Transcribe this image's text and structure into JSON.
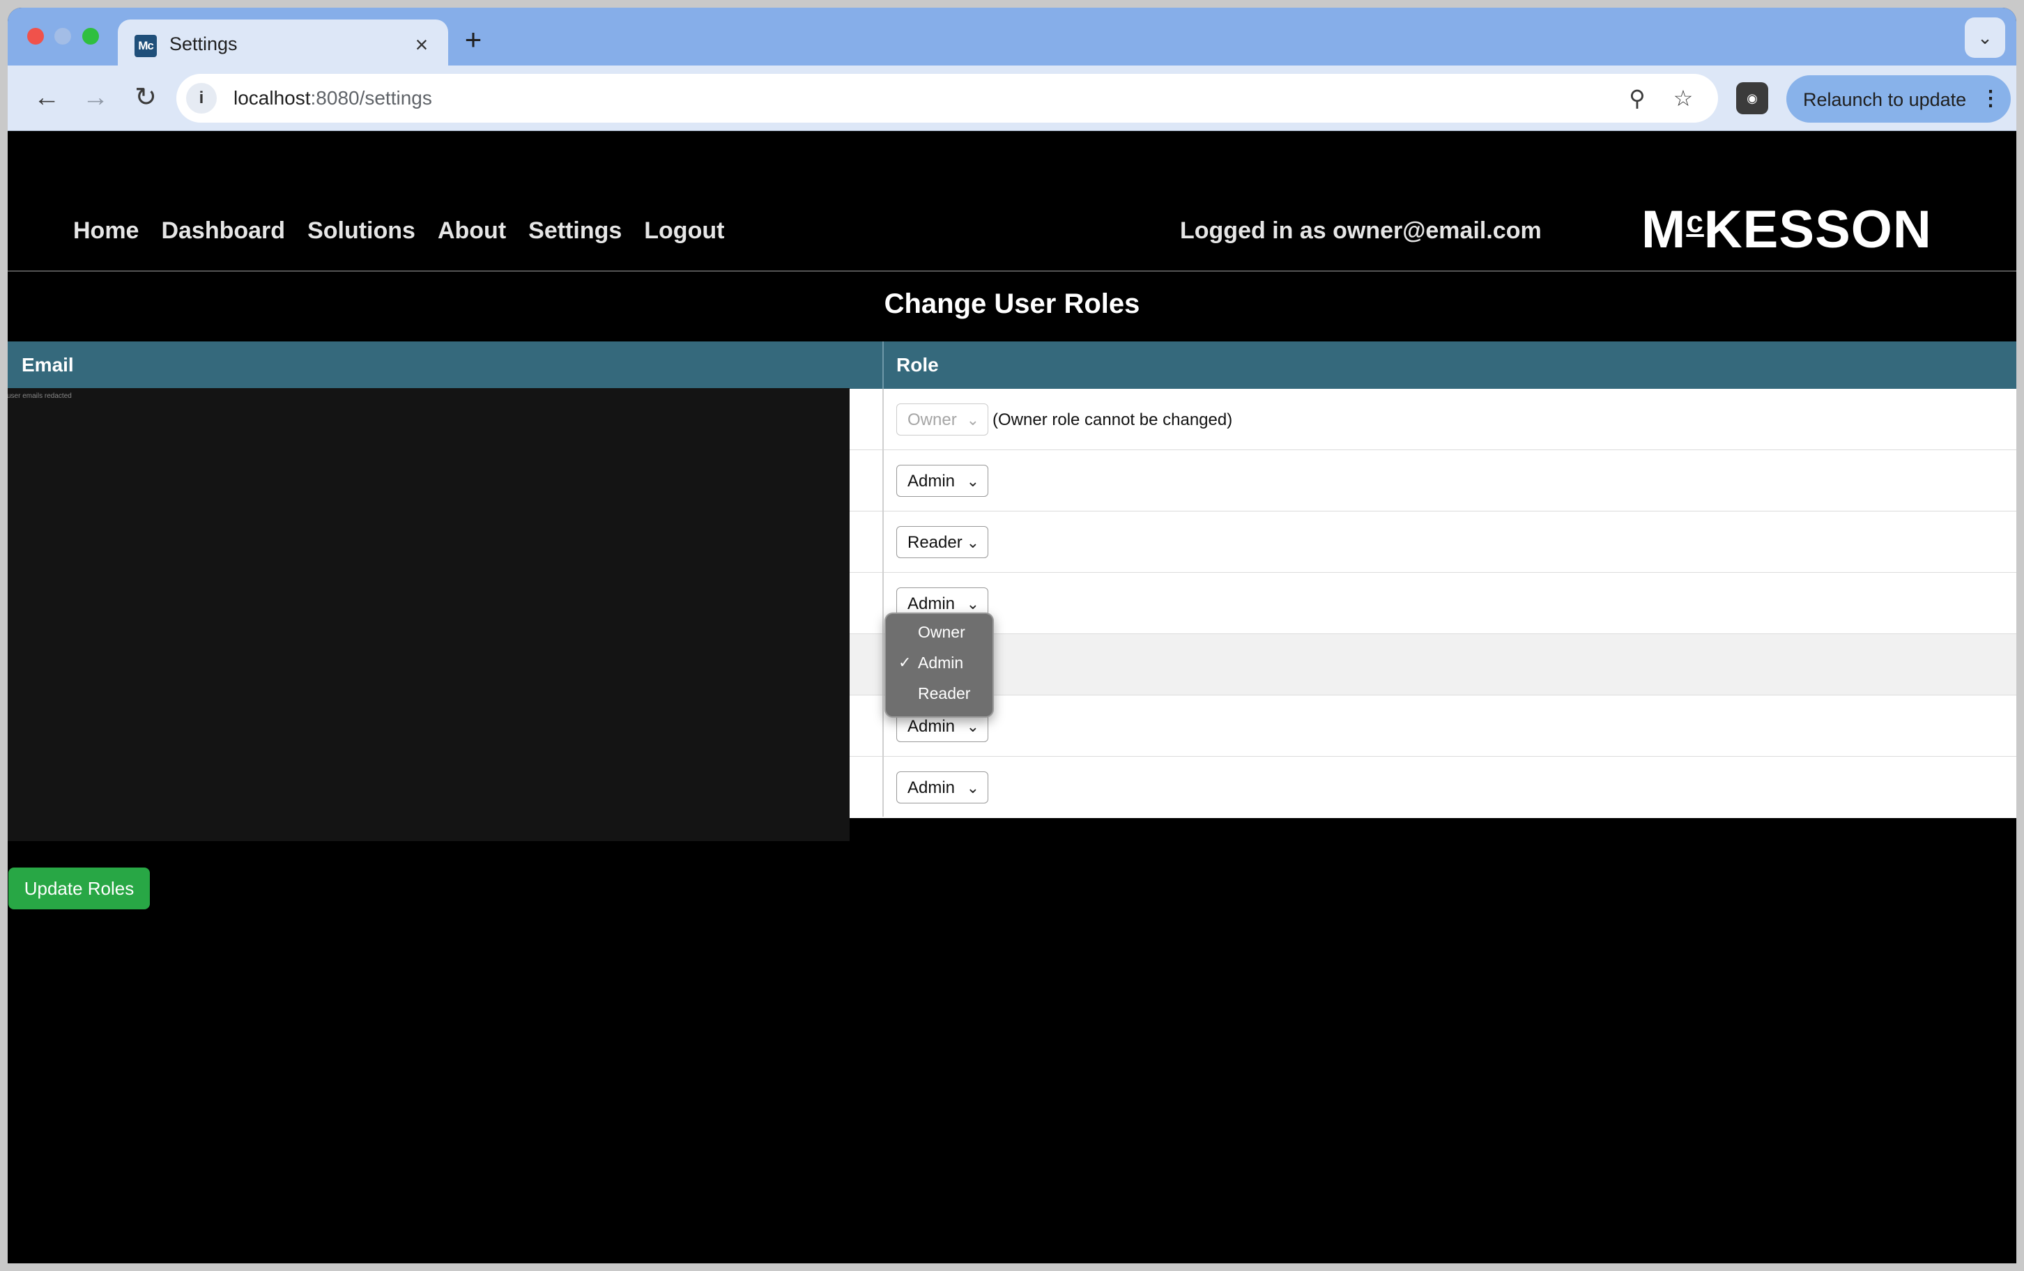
{
  "browser": {
    "tab_title": "Settings",
    "tab_favicon": "Mc",
    "url_host": "localhost",
    "url_path": ":8080/settings",
    "relaunch_label": "Relaunch to update",
    "icons": {
      "back": "arrow-left-icon",
      "forward": "arrow-right-icon",
      "reload": "reload-icon",
      "info": "info-icon",
      "zoom": "zoom-icon",
      "star": "star-icon",
      "close": "close-icon",
      "new_tab": "plus-icon"
    }
  },
  "nav": {
    "links": [
      "Home",
      "Dashboard",
      "Solutions",
      "About",
      "Settings",
      "Logout"
    ],
    "logged_in": "Logged in as owner@email.com",
    "logo_pre": "M",
    "logo_sup": "c",
    "logo_post": "KESSON"
  },
  "page": {
    "title": "Change User Roles",
    "redaction_note": "user emails redacted",
    "update_button": "Update Roles"
  },
  "table": {
    "headers": {
      "email": "Email",
      "role": "Role"
    },
    "rows": [
      {
        "role": "Owner",
        "disabled": true,
        "note": "(Owner role cannot be changed)"
      },
      {
        "role": "Admin"
      },
      {
        "role": "Reader"
      },
      {
        "role": "Admin"
      },
      {
        "role": "Admin"
      },
      {
        "role": "Admin"
      },
      {
        "role": "Admin"
      }
    ]
  },
  "dropdown": {
    "options": [
      "Owner",
      "Admin",
      "Reader"
    ],
    "selected": "Admin",
    "check": "✓"
  },
  "colors": {
    "header_bg": "#35697c",
    "button_bg": "#28a745",
    "page_bg": "#000000"
  }
}
